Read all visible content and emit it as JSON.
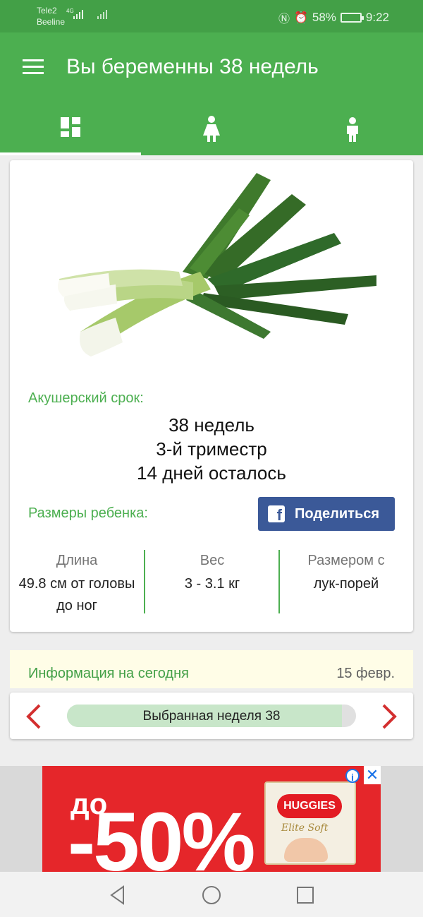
{
  "status_bar": {
    "carrier_1": "Tele2",
    "carrier_2": "Beeline",
    "network": "4G",
    "battery": "58%",
    "time": "9:22",
    "icons": [
      "nfc-icon",
      "alarm-icon",
      "battery-charging-icon"
    ]
  },
  "app_bar": {
    "title": "Вы беременны 38 недель",
    "tabs": [
      {
        "icon": "dashboard-icon",
        "selected": true
      },
      {
        "icon": "woman-icon",
        "selected": false
      },
      {
        "icon": "child-icon",
        "selected": false
      }
    ]
  },
  "baby_card": {
    "image": "leek-image",
    "term_label": "Акушерский срок:",
    "weeks": "38 недель",
    "trimester": "3-й триместр",
    "days_left": "14 дней осталось",
    "size_label": "Размеры ребенка:",
    "share_label": "Поделиться",
    "stats": [
      {
        "header": "Длина",
        "value": "49.8 см от головы до ног"
      },
      {
        "header": "Вес",
        "value": "3 - 3.1 кг"
      },
      {
        "header": "Размером с",
        "value": "лук-порей"
      }
    ]
  },
  "info": {
    "title": "Информация на сегодня",
    "date": "15 февр."
  },
  "week_selector": {
    "label": "Выбранная неделя 38",
    "progress": 0.95
  },
  "ad": {
    "prefix": "до",
    "discount": "-50%",
    "brand": "HUGGIES",
    "product_line": "Elite Soft"
  },
  "colors": {
    "primary": "#4caf50",
    "primary_dark": "#43a047",
    "facebook": "#3b5998",
    "arrow": "#d32f2f",
    "ad_red": "#e5262a"
  }
}
